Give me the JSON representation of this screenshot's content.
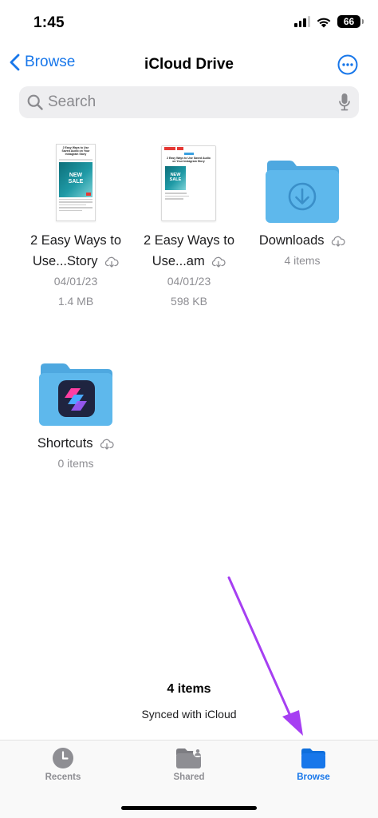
{
  "status": {
    "time": "1:45",
    "battery": "66"
  },
  "nav": {
    "back_label": "Browse",
    "title": "iCloud Drive"
  },
  "search": {
    "placeholder": "Search"
  },
  "items": [
    {
      "name": "2 Easy Ways to",
      "name2": "Use...Story",
      "date": "04/01/23",
      "size": "1.4 MB",
      "thumb_heading": "2 Easy Ways to Use Saved Audio on Your Instagram Story",
      "thumb_badge1": "NEW",
      "thumb_badge2": "SALE"
    },
    {
      "name": "2 Easy Ways to",
      "name2": "Use...am",
      "date": "04/01/23",
      "size": "598 KB",
      "thumb_heading": "2 Easy Ways to Use Saved Audio on Your Instagram Story",
      "thumb_badge1": "NEW",
      "thumb_badge2": "SALE"
    },
    {
      "name": "Downloads",
      "count": "4 items"
    },
    {
      "name": "Shortcuts",
      "count": "0 items"
    }
  ],
  "footer": {
    "count": "4 items",
    "sync": "Synced with iCloud"
  },
  "tabs": [
    {
      "label": "Recents",
      "icon": "clock-icon"
    },
    {
      "label": "Shared",
      "icon": "shared-folder-icon"
    },
    {
      "label": "Browse",
      "icon": "folder-icon"
    }
  ],
  "colors": {
    "accent": "#1877ea",
    "folder": "#5eb8ec",
    "annotation": "#a63ff2"
  }
}
